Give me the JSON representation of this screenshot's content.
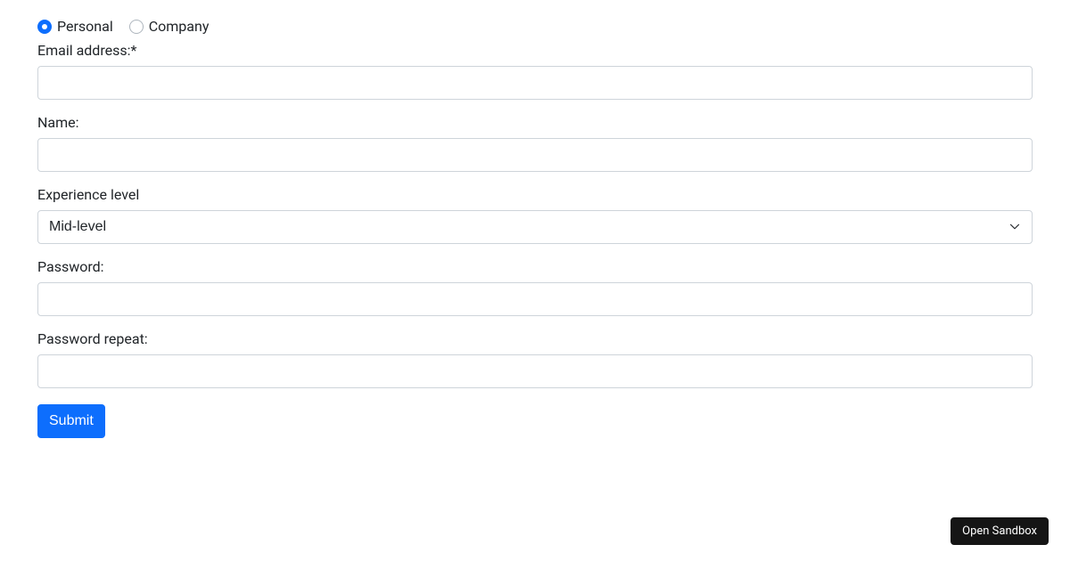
{
  "form": {
    "account_type": {
      "options": [
        {
          "value": "personal",
          "label": "Personal",
          "selected": true
        },
        {
          "value": "company",
          "label": "Company",
          "selected": false
        }
      ]
    },
    "email": {
      "label": "Email address:*",
      "value": ""
    },
    "name": {
      "label": "Name:",
      "value": ""
    },
    "experience": {
      "label": "Experience level",
      "selected": "Mid-level"
    },
    "password": {
      "label": "Password:",
      "value": ""
    },
    "password_repeat": {
      "label": "Password repeat:",
      "value": ""
    },
    "submit_label": "Submit"
  },
  "footer": {
    "open_sandbox_label": "Open Sandbox"
  }
}
